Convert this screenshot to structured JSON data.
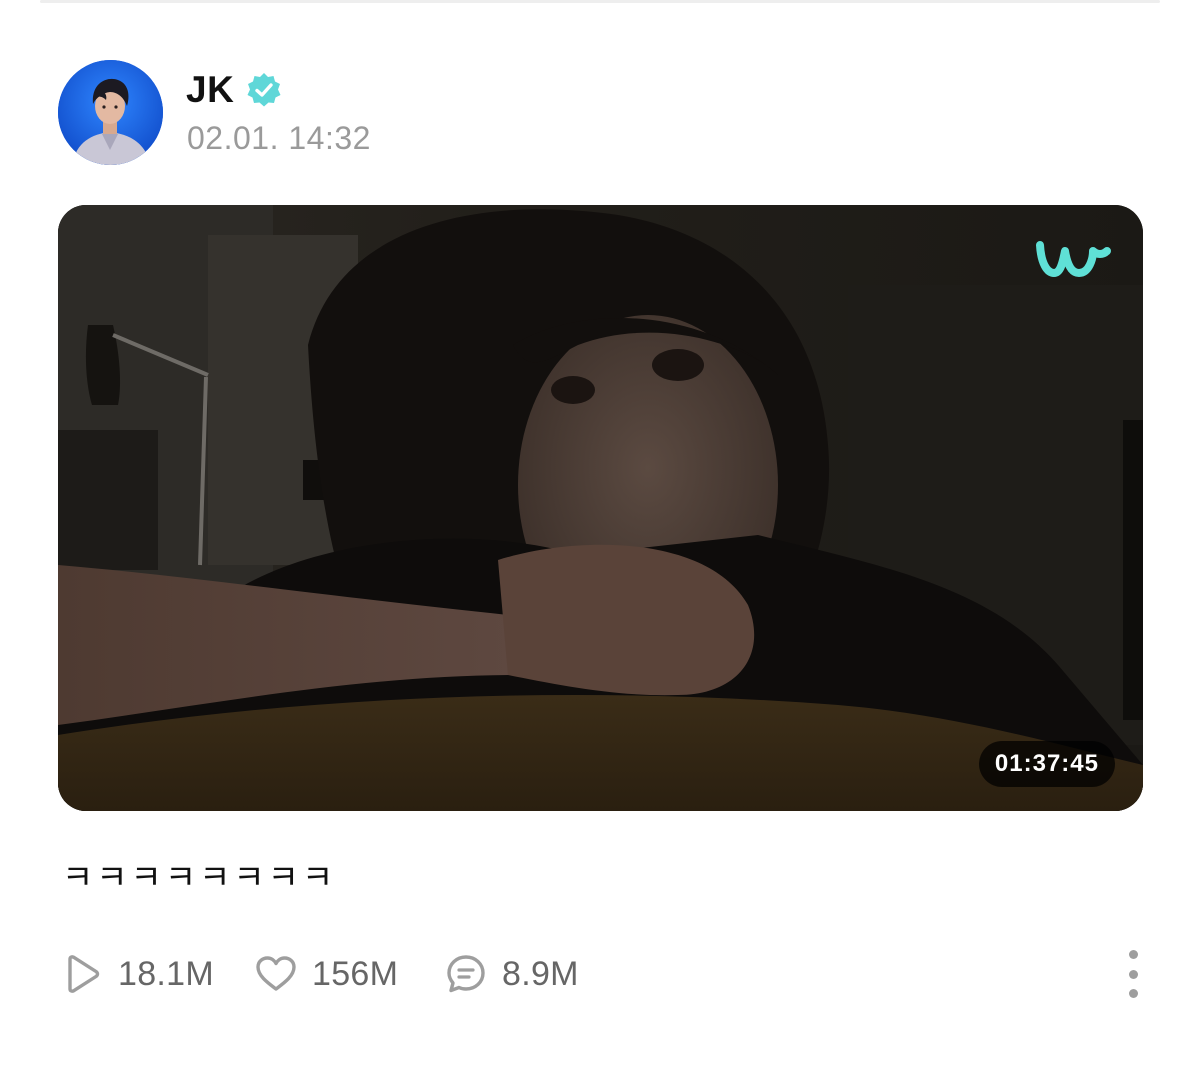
{
  "post": {
    "author": {
      "name": "JK",
      "verified": true,
      "avatar_icon": "profile-photo"
    },
    "timestamp": "02.01. 14:32",
    "video": {
      "duration": "01:37:45",
      "watermark_icon": "weverse-logo"
    },
    "text": "ㅋㅋㅋㅋㅋㅋㅋㅋ",
    "stats": {
      "plays": "18.1M",
      "likes": "156M",
      "comments": "8.9M"
    }
  },
  "colors": {
    "verified_badge": "#5fd7d8",
    "weverse_logo": "#5fe0d6",
    "muted_text": "#9a9a9a",
    "stat_text": "#666666"
  }
}
